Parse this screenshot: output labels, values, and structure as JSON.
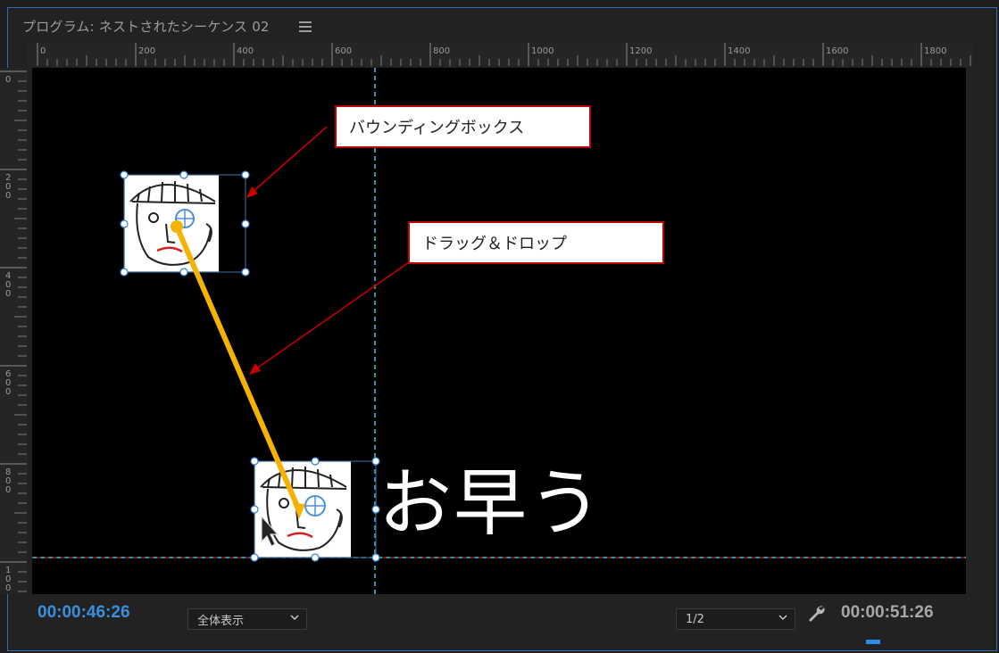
{
  "panel": {
    "title": "プログラム: ネストされたシーケンス 02",
    "menu_icon": "hamburger-menu-icon"
  },
  "ruler": {
    "horizontal_labels": [
      "0",
      "200",
      "400",
      "600",
      "800",
      "1000",
      "1200",
      "1400",
      "1600",
      "1800"
    ],
    "vertical_labels": [
      "0",
      "2\n0\n0",
      "4\n0\n0",
      "6\n0\n0",
      "8\n0\n0",
      "1\n0\n0"
    ]
  },
  "annotations": {
    "bounding_box_label": "バウンディングボックス",
    "drag_drop_label": "ドラッグ＆ドロップ",
    "arrow_color": "#cc0000",
    "drag_line_color": "#f5b301"
  },
  "video": {
    "caption_text": "お早う",
    "guide_color": "#3cc8e8"
  },
  "controls": {
    "current_timecode": "00:00:46:26",
    "zoom_select": "全体表示",
    "resolution_select": "1/2",
    "settings_icon": "wrench-icon",
    "duration_timecode": "00:00:51:26"
  },
  "colors": {
    "accent_blue": "#3b8fe0",
    "panel_border": "#2d6db5"
  }
}
